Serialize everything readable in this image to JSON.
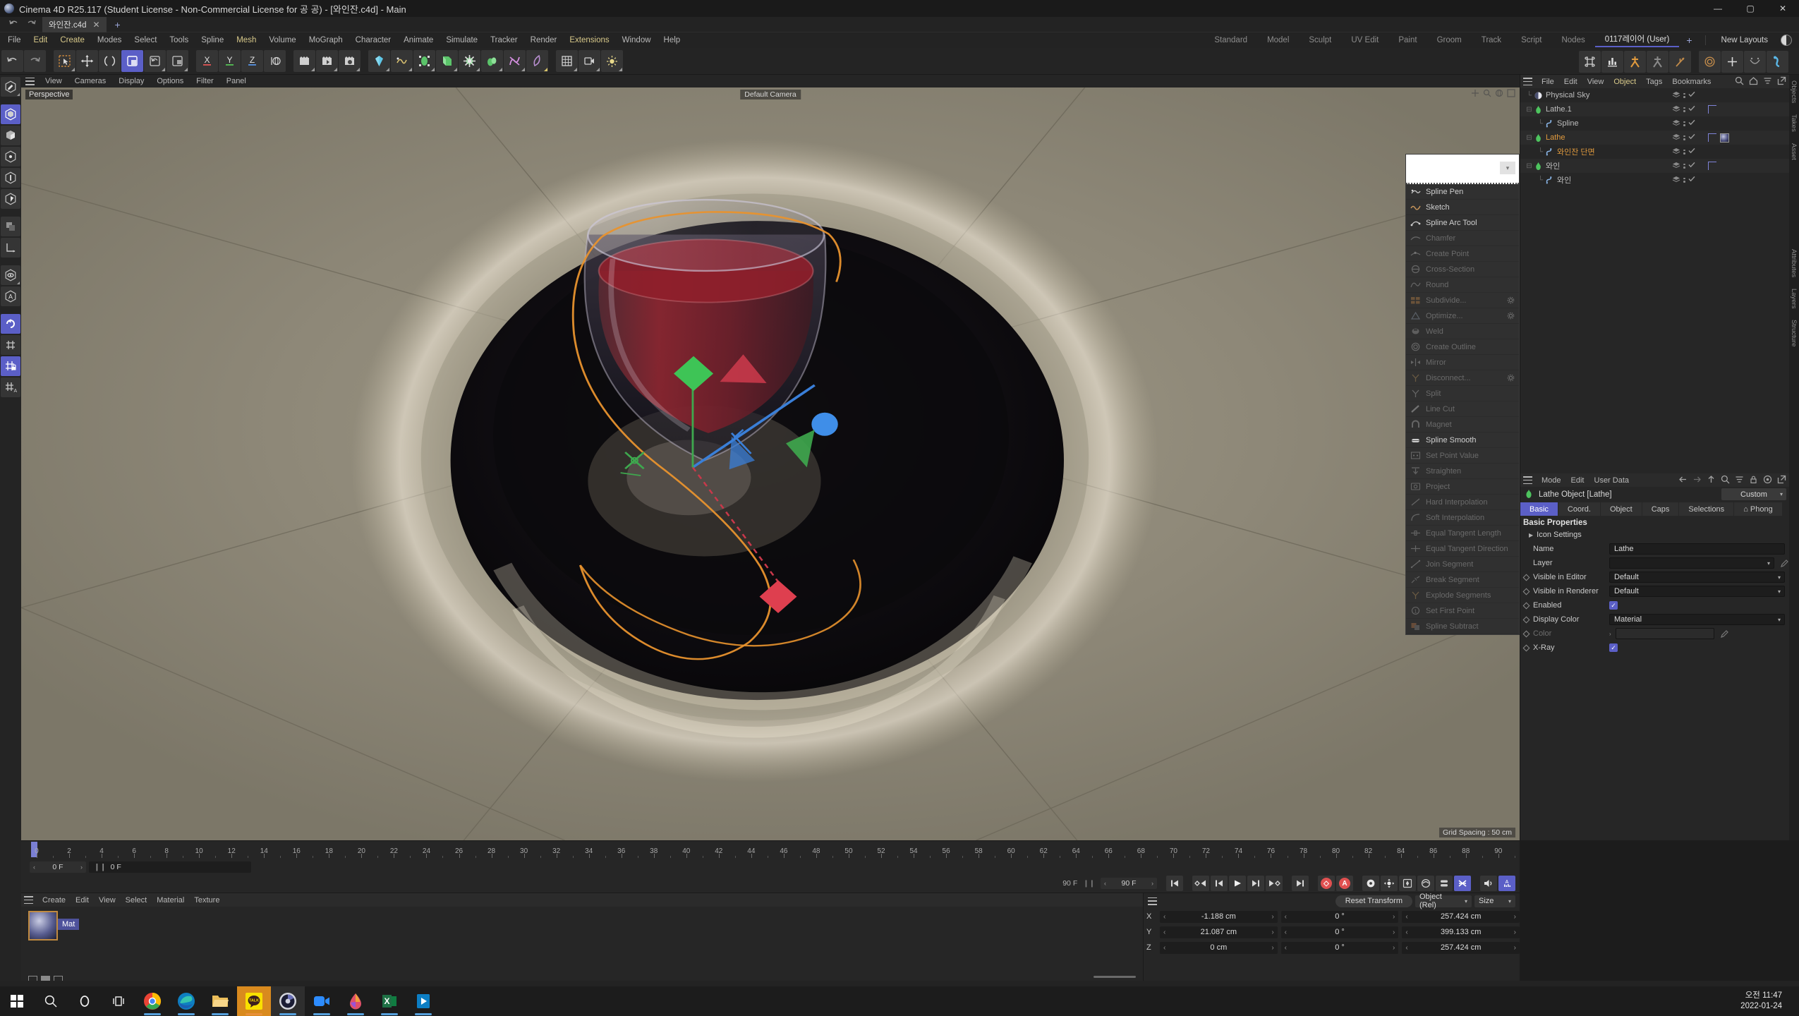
{
  "window": {
    "title": "Cinema 4D R25.117 (Student License - Non-Commercial License for 공 공) - [와인잔.c4d] - Main",
    "minimize": "—",
    "maximize": "▢",
    "close": "✕"
  },
  "file_tabs": {
    "active": "와인잔.c4d",
    "close": "✕",
    "add": "+"
  },
  "menubar": {
    "items": [
      {
        "label": "File",
        "hl": false
      },
      {
        "label": "Edit",
        "hl": true
      },
      {
        "label": "Create",
        "hl": true
      },
      {
        "label": "Modes",
        "hl": false
      },
      {
        "label": "Select",
        "hl": false
      },
      {
        "label": "Tools",
        "hl": false
      },
      {
        "label": "Spline",
        "hl": false
      },
      {
        "label": "Mesh",
        "hl": true
      },
      {
        "label": "Volume",
        "hl": false
      },
      {
        "label": "MoGraph",
        "hl": false
      },
      {
        "label": "Character",
        "hl": false
      },
      {
        "label": "Animate",
        "hl": false
      },
      {
        "label": "Simulate",
        "hl": false
      },
      {
        "label": "Tracker",
        "hl": false
      },
      {
        "label": "Render",
        "hl": false
      },
      {
        "label": "Extensions",
        "hl": true
      },
      {
        "label": "Window",
        "hl": false
      },
      {
        "label": "Help",
        "hl": false
      }
    ]
  },
  "layouts": {
    "items": [
      "Standard",
      "Model",
      "Sculpt",
      "UV Edit",
      "Paint",
      "Groom",
      "Track",
      "Script",
      "Nodes"
    ],
    "active": "0117레이어 (User)",
    "add": "+",
    "new_layouts": "New Layouts"
  },
  "viewport": {
    "menu": [
      "View",
      "Cameras",
      "Display",
      "Options",
      "Filter",
      "Panel"
    ],
    "perspective_label": "Perspective",
    "camera_label": "Default Camera",
    "grid_spacing": "Grid Spacing : 50 cm"
  },
  "context_menu": {
    "items": [
      {
        "label": "Spline Pen",
        "enabled": true,
        "gear": false
      },
      {
        "label": "Sketch",
        "enabled": true,
        "gear": false
      },
      {
        "label": "Spline Arc Tool",
        "enabled": true,
        "gear": false
      },
      {
        "label": "Chamfer",
        "enabled": false,
        "gear": false
      },
      {
        "label": "Create Point",
        "enabled": false,
        "gear": false
      },
      {
        "label": "Cross-Section",
        "enabled": false,
        "gear": false
      },
      {
        "label": "Round",
        "enabled": false,
        "gear": false
      },
      {
        "label": "Subdivide...",
        "enabled": false,
        "gear": true
      },
      {
        "label": "Optimize...",
        "enabled": false,
        "gear": true
      },
      {
        "label": "Weld",
        "enabled": false,
        "gear": false
      },
      {
        "label": "Create Outline",
        "enabled": false,
        "gear": false
      },
      {
        "label": "Mirror",
        "enabled": false,
        "gear": false
      },
      {
        "label": "Disconnect...",
        "enabled": false,
        "gear": true
      },
      {
        "label": "Split",
        "enabled": false,
        "gear": false
      },
      {
        "label": "Line Cut",
        "enabled": false,
        "gear": false
      },
      {
        "label": "Magnet",
        "enabled": false,
        "gear": false
      },
      {
        "label": "Spline Smooth",
        "enabled": true,
        "gear": false
      },
      {
        "label": "Set Point Value",
        "enabled": false,
        "gear": false
      },
      {
        "label": "Straighten",
        "enabled": false,
        "gear": false
      },
      {
        "label": "Project",
        "enabled": false,
        "gear": false
      },
      {
        "label": "Hard Interpolation",
        "enabled": false,
        "gear": false
      },
      {
        "label": "Soft Interpolation",
        "enabled": false,
        "gear": false
      },
      {
        "label": "Equal Tangent Length",
        "enabled": false,
        "gear": false
      },
      {
        "label": "Equal Tangent Direction",
        "enabled": false,
        "gear": false
      },
      {
        "label": "Join Segment",
        "enabled": false,
        "gear": false
      },
      {
        "label": "Break Segment",
        "enabled": false,
        "gear": false
      },
      {
        "label": "Explode Segments",
        "enabled": false,
        "gear": false
      },
      {
        "label": "Set First Point",
        "enabled": false,
        "gear": false
      },
      {
        "label": "Spline Subtract",
        "enabled": false,
        "gear": false
      }
    ]
  },
  "object_manager": {
    "menu": [
      {
        "label": "File",
        "hl": false
      },
      {
        "label": "Edit",
        "hl": false
      },
      {
        "label": "View",
        "hl": false
      },
      {
        "label": "Object",
        "hl": true
      },
      {
        "label": "Tags",
        "hl": false
      },
      {
        "label": "Bookmarks",
        "hl": false
      }
    ],
    "icons": [
      "search-icon",
      "home-icon",
      "filter-icon",
      "popout-icon"
    ],
    "rows": [
      {
        "name": "Physical Sky",
        "depth": 0,
        "type": "sky",
        "selected": false,
        "expander": "",
        "tags": []
      },
      {
        "name": "Lathe.1",
        "depth": 0,
        "type": "generator",
        "selected": false,
        "expander": "-",
        "tags": [
          "flag"
        ]
      },
      {
        "name": "Spline",
        "depth": 1,
        "type": "spline",
        "selected": false,
        "expander": "",
        "tags": []
      },
      {
        "name": "Lathe",
        "depth": 0,
        "type": "generator",
        "selected": true,
        "expander": "-",
        "tags": [
          "flag",
          "material"
        ]
      },
      {
        "name": "와인잔 단면",
        "depth": 1,
        "type": "spline",
        "selected": true,
        "expander": "",
        "tags": []
      },
      {
        "name": "와인",
        "depth": 0,
        "type": "generator",
        "selected": false,
        "expander": "-",
        "tags": [
          "flag"
        ]
      },
      {
        "name": "와인",
        "depth": 1,
        "type": "spline",
        "selected": false,
        "expander": "",
        "tags": []
      }
    ],
    "side_tabs": [
      "Objects",
      "Takes",
      "Asset"
    ]
  },
  "attributes": {
    "menu": [
      "Mode",
      "Edit",
      "User Data"
    ],
    "icons": [
      "back-arrow-icon",
      "forward-arrow-icon",
      "up-arrow-icon",
      "search-icon",
      "filter-icon",
      "lock-icon",
      "target-icon",
      "popout-icon"
    ],
    "object_title": "Lathe Object [Lathe]",
    "preset": "Custom",
    "tabs": [
      {
        "label": "Basic",
        "active": true
      },
      {
        "label": "Coord.",
        "active": false
      },
      {
        "label": "Object",
        "active": false
      },
      {
        "label": "Caps",
        "active": false
      },
      {
        "label": "Selections",
        "active": false
      },
      {
        "label": "⌂ Phong",
        "active": false
      }
    ],
    "section_title": "Basic Properties",
    "icon_settings": "Icon Settings",
    "fields": [
      {
        "label": "Name",
        "value": "Lathe",
        "kind": "text",
        "dim": false
      },
      {
        "label": "Layer",
        "value": "",
        "kind": "layer",
        "dim": false
      },
      {
        "label": "Visible in Editor",
        "value": "Default",
        "kind": "select",
        "dim": false
      },
      {
        "label": "Visible in Renderer",
        "value": "Default",
        "kind": "select",
        "dim": false
      },
      {
        "label": "Enabled",
        "value": "✓",
        "kind": "check",
        "dim": false
      },
      {
        "label": "Display Color",
        "value": "Material",
        "kind": "select",
        "dim": false
      },
      {
        "label": "Color",
        "value": "",
        "kind": "color",
        "dim": true
      },
      {
        "label": "X-Ray",
        "value": "✓",
        "kind": "check",
        "dim": false
      }
    ],
    "side_tabs": [
      "Attributes",
      "Layers",
      "Structure"
    ]
  },
  "timeline": {
    "ticks": [
      "0",
      "2",
      "4",
      "6",
      "8",
      "10",
      "12",
      "14",
      "16",
      "18",
      "20",
      "22",
      "24",
      "26",
      "28",
      "30",
      "32",
      "34",
      "36",
      "38",
      "40",
      "42",
      "44",
      "46",
      "48",
      "50",
      "52",
      "54",
      "56",
      "58",
      "60",
      "62",
      "64",
      "66",
      "68",
      "70",
      "72",
      "74",
      "76",
      "78",
      "80",
      "82",
      "84",
      "86",
      "88",
      "90"
    ],
    "current_frame": "0 F",
    "current_display": "0 F",
    "end_frame_left": "90 F",
    "end_frame_right": "90 F"
  },
  "material_manager": {
    "menu": [
      "Create",
      "Edit",
      "View",
      "Select",
      "Material",
      "Texture"
    ],
    "materials": [
      {
        "name": "Mat"
      }
    ]
  },
  "coordinates": {
    "reset_label": "Reset Transform",
    "mode": "Object (Rel)",
    "size_mode": "Size",
    "rows": [
      {
        "axis": "X",
        "position": "-1.188 cm",
        "rotation": "0 °",
        "size": "257.424 cm"
      },
      {
        "axis": "Y",
        "position": "21.087 cm",
        "rotation": "0 °",
        "size": "399.133 cm"
      },
      {
        "axis": "Z",
        "position": "0 cm",
        "rotation": "0 °",
        "size": "257.424 cm"
      }
    ]
  },
  "taskbar": {
    "items": [
      "start-icon",
      "search-icon",
      "cortana-icon",
      "task-view-icon",
      "chrome-icon",
      "edge-icon",
      "explorer-icon",
      "kakaotalk-icon",
      "cinema4d-icon",
      "zoom-icon",
      "paint3d-icon",
      "excel-icon",
      "video-editor-icon"
    ],
    "clock_time": "오전 11:47",
    "clock_date": "2022-01-24"
  },
  "colors": {
    "accent": "#5b5fc7",
    "menu_highlight": "#d8c98a",
    "selected_object": "#e09a3e",
    "record_red": "#e05050"
  }
}
